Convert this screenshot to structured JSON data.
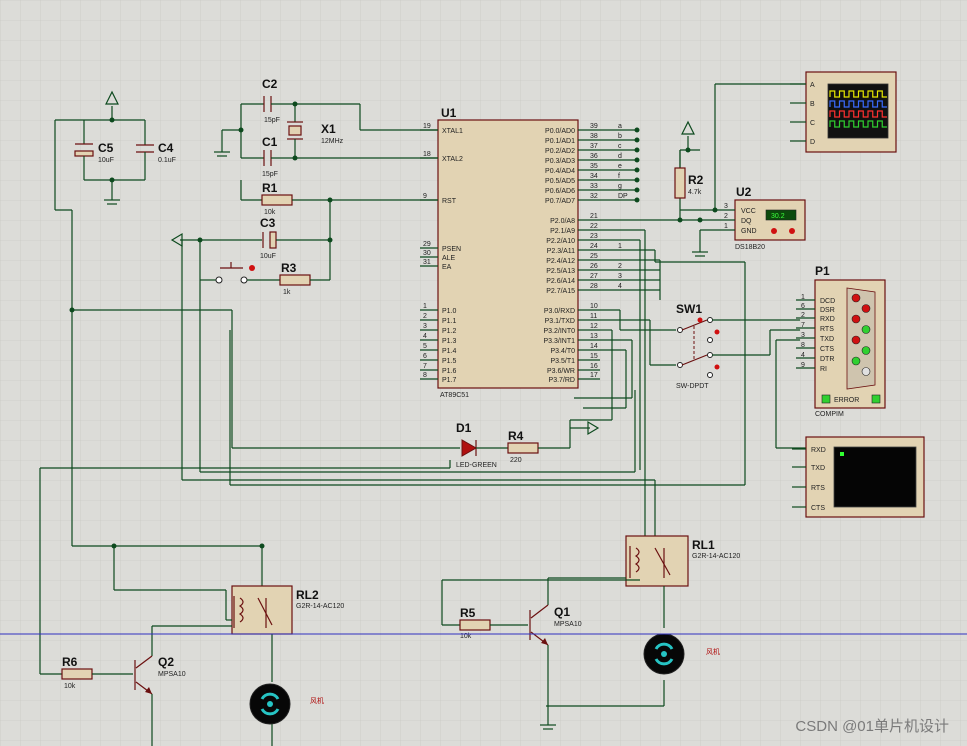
{
  "watermark": "CSDN @01单片机设计",
  "u1": {
    "ref": "U1",
    "part": "AT89C51",
    "left_pins": [
      {
        "num": "19",
        "name": "XTAL1"
      },
      {
        "num": "18",
        "name": "XTAL2"
      },
      {
        "num": "9",
        "name": "RST"
      },
      {
        "num": "29",
        "name": "PSEN"
      },
      {
        "num": "30",
        "name": "ALE"
      },
      {
        "num": "31",
        "name": "EA"
      },
      {
        "num": "1",
        "name": "P1.0"
      },
      {
        "num": "2",
        "name": "P1.1"
      },
      {
        "num": "3",
        "name": "P1.2"
      },
      {
        "num": "4",
        "name": "P1.3"
      },
      {
        "num": "5",
        "name": "P1.4"
      },
      {
        "num": "6",
        "name": "P1.5"
      },
      {
        "num": "7",
        "name": "P1.6"
      },
      {
        "num": "8",
        "name": "P1.7"
      }
    ],
    "right_pins": [
      {
        "num": "39",
        "name": "P0.0/AD0",
        "net": "a"
      },
      {
        "num": "38",
        "name": "P0.1/AD1",
        "net": "b"
      },
      {
        "num": "37",
        "name": "P0.2/AD2",
        "net": "c"
      },
      {
        "num": "36",
        "name": "P0.3/AD3",
        "net": "d"
      },
      {
        "num": "35",
        "name": "P0.4/AD4",
        "net": "e"
      },
      {
        "num": "34",
        "name": "P0.5/AD5",
        "net": "f"
      },
      {
        "num": "33",
        "name": "P0.6/AD6",
        "net": "g"
      },
      {
        "num": "32",
        "name": "P0.7/AD7",
        "net": "DP"
      },
      {
        "num": "21",
        "name": "P2.0/A8",
        "net": ""
      },
      {
        "num": "22",
        "name": "P2.1/A9",
        "net": ""
      },
      {
        "num": "23",
        "name": "P2.2/A10",
        "net": ""
      },
      {
        "num": "24",
        "name": "P2.3/A11",
        "net": "1"
      },
      {
        "num": "25",
        "name": "P2.4/A12",
        "net": ""
      },
      {
        "num": "26",
        "name": "P2.5/A13",
        "net": "2"
      },
      {
        "num": "27",
        "name": "P2.6/A14",
        "net": "3"
      },
      {
        "num": "28",
        "name": "P2.7/A15",
        "net": "4"
      },
      {
        "num": "10",
        "name": "P3.0/RXD",
        "net": ""
      },
      {
        "num": "11",
        "name": "P3.1/TXD",
        "net": ""
      },
      {
        "num": "12",
        "name": "P3.2/INT0",
        "net": ""
      },
      {
        "num": "13",
        "name": "P3.3/INT1",
        "net": ""
      },
      {
        "num": "14",
        "name": "P3.4/T0",
        "net": ""
      },
      {
        "num": "15",
        "name": "P3.5/T1",
        "net": ""
      },
      {
        "num": "16",
        "name": "P3.6/WR",
        "net": ""
      },
      {
        "num": "17",
        "name": "P3.7/RD",
        "net": ""
      }
    ]
  },
  "components": {
    "c1": {
      "ref": "C1",
      "value": "15pF"
    },
    "c2": {
      "ref": "C2",
      "value": "15pF"
    },
    "c3": {
      "ref": "C3",
      "value": "10uF"
    },
    "c4": {
      "ref": "C4",
      "value": "0.1uF"
    },
    "c5": {
      "ref": "C5",
      "value": "10uF"
    },
    "x1": {
      "ref": "X1",
      "value": "12MHz"
    },
    "r1": {
      "ref": "R1",
      "value": "10k"
    },
    "r2": {
      "ref": "R2",
      "value": "4.7k"
    },
    "r3": {
      "ref": "R3",
      "value": "1k"
    },
    "r4": {
      "ref": "R4",
      "value": "220"
    },
    "r5": {
      "ref": "R5",
      "value": "10k"
    },
    "r6": {
      "ref": "R6",
      "value": "10k"
    },
    "d1": {
      "ref": "D1",
      "value": "LED-GREEN"
    },
    "q1": {
      "ref": "Q1",
      "value": "MPSA10"
    },
    "q2": {
      "ref": "Q2",
      "value": "MPSA10"
    },
    "rl1": {
      "ref": "RL1",
      "value": "G2R-14-AC120"
    },
    "rl2": {
      "ref": "RL2",
      "value": "G2R-14-AC120"
    },
    "sw1": {
      "ref": "SW1",
      "value": "SW-DPDT"
    },
    "fan1": {
      "label": "风机"
    },
    "fan2": {
      "label": "风机"
    }
  },
  "u2": {
    "ref": "U2",
    "part": "DS18B20",
    "pins": [
      {
        "num": "3",
        "name": "VCC"
      },
      {
        "num": "2",
        "name": "DQ"
      },
      {
        "num": "1",
        "name": "GND"
      }
    ],
    "display": "30.2"
  },
  "p1": {
    "ref": "P1",
    "part": "COMPIM",
    "status": "ERROR",
    "pins": [
      {
        "num": "1",
        "name": "DCD"
      },
      {
        "num": "6",
        "name": "DSR"
      },
      {
        "num": "2",
        "name": "RXD"
      },
      {
        "num": "7",
        "name": "RTS"
      },
      {
        "num": "3",
        "name": "TXD"
      },
      {
        "num": "8",
        "name": "CTS"
      },
      {
        "num": "4",
        "name": "DTR"
      },
      {
        "num": "9",
        "name": "RI"
      }
    ]
  },
  "terminal": {
    "pins": [
      "RXD",
      "TXD",
      "RTS",
      "CTS"
    ]
  },
  "oscilloscope": {
    "channels": [
      "A",
      "B",
      "C",
      "D"
    ],
    "trace_colors": [
      "#e8e800",
      "#3a6bff",
      "#ff3030",
      "#30d030"
    ]
  },
  "colors": {
    "background": "#dcdcd8",
    "wire": "#0d4a1e",
    "component_outline": "#6b1010",
    "component_fill": "#e2d3b3",
    "crosshair": "#3030c0"
  }
}
